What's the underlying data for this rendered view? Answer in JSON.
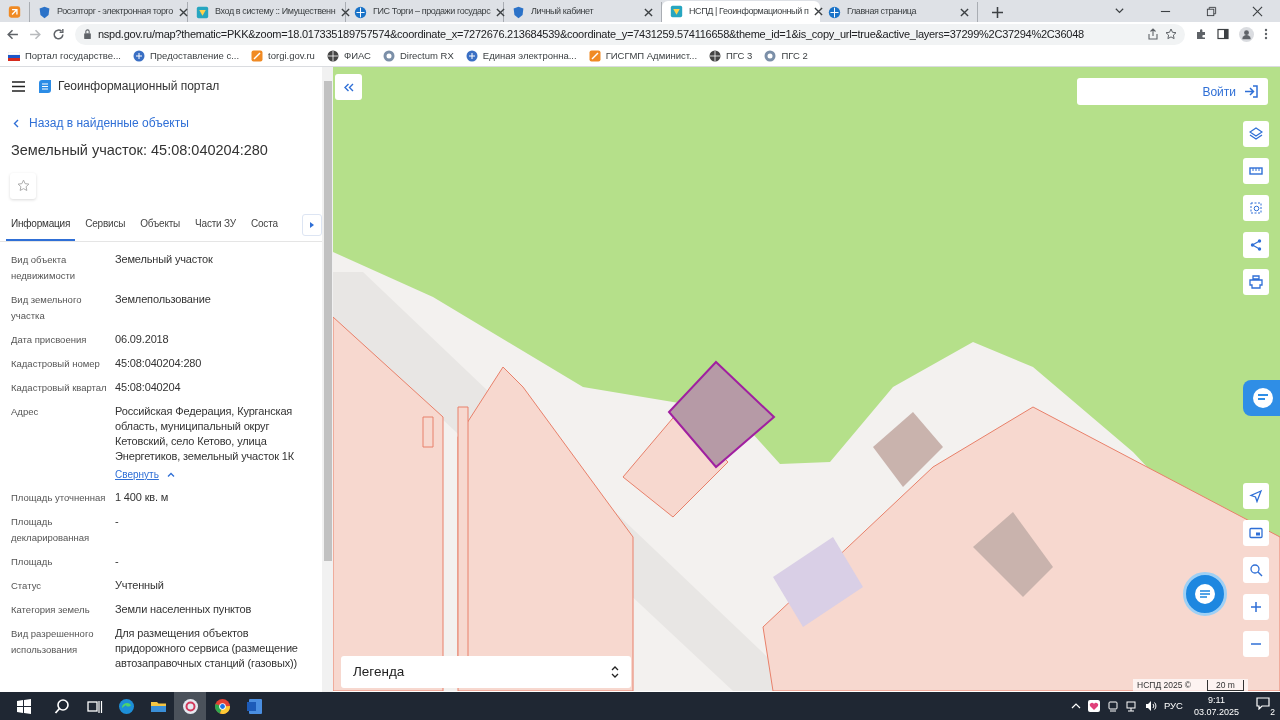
{
  "browser": {
    "tabs": [
      {
        "kind": "pinned",
        "selected": false
      },
      {
        "title": "Росэлторг - электронная торго",
        "kind": "normal",
        "selected": false
      },
      {
        "title": "Вход в систему :: Имущественн",
        "kind": "normal",
        "selected": false
      },
      {
        "title": "ГИС Торги – продажи государс",
        "kind": "normal",
        "selected": false
      },
      {
        "title": "Личный кабинет",
        "kind": "normal",
        "selected": false
      },
      {
        "title": "НСПД | Геоинформационный п",
        "kind": "normal",
        "selected": true
      },
      {
        "title": "Главная страница",
        "kind": "normal",
        "selected": false
      }
    ],
    "url": "nspd.gov.ru/map?thematic=PKK&zoom=18.017335189757574&coordinate_x=7272676.213684539&coordinate_y=7431259.574116658&theme_id=1&is_copy_url=true&active_layers=37299%2C37294%2C36048",
    "bookmarks": [
      {
        "title": "Портал государстве...",
        "kind": "flag"
      },
      {
        "title": "Предоставление с...",
        "kind": "site"
      },
      {
        "title": "torgi.gov.ru",
        "kind": "site"
      },
      {
        "title": "ФИАС",
        "kind": "site"
      },
      {
        "title": "Directum RX",
        "kind": "site"
      },
      {
        "title": "Единая электронна...",
        "kind": "site"
      },
      {
        "title": "ГИСГМП Админист...",
        "kind": "site"
      },
      {
        "title": "ПГС 3",
        "kind": "site"
      },
      {
        "title": "ПГС 2",
        "kind": "site"
      }
    ]
  },
  "app": {
    "title": "Геоинформационный портал",
    "back_link": "Назад в найденные объекты",
    "object_title": "Земельный участок: 45:08:040204:280",
    "tabs": [
      {
        "label": "Информация",
        "selected": true
      },
      {
        "label": "Сервисы",
        "selected": false
      },
      {
        "label": "Объекты",
        "selected": false
      },
      {
        "label": "Части ЗУ",
        "selected": false
      },
      {
        "label": "Соста",
        "selected": false
      }
    ],
    "fields": [
      {
        "label": "Вид объекта недвижимости",
        "value": "Земельный участок"
      },
      {
        "label": "Вид земельного участка",
        "value": "Землепользование"
      },
      {
        "label": "Дата присвоения",
        "value": "06.09.2018"
      },
      {
        "label": "Кадастровый номер",
        "value": "45:08:040204:280"
      },
      {
        "label": "Кадастровый квартал",
        "value": "45:08:040204"
      },
      {
        "label": "Адрес",
        "value": "Российская Федерация, Курганская область, муниципальный округ Кетовский, село Кетово, улица Энергетиков, земельный участок 1К",
        "collapse_link": "Свернуть"
      },
      {
        "label": "Площадь уточненная",
        "value": "1 400 кв. м"
      },
      {
        "label": "Площадь декларированная",
        "value": "-"
      },
      {
        "label": "Площадь",
        "value": "-"
      },
      {
        "label": "Статус",
        "value": "Учтенный"
      },
      {
        "label": "Категория земель",
        "value": "Земли населенных пунктов"
      },
      {
        "label": "Вид разрешенного использования",
        "value": "Для размещения объектов придорожного сервиса (размещение автозаправочных станций (газовых))"
      }
    ]
  },
  "map": {
    "login": "Войти",
    "legend": "Легенда",
    "attribution": "НСПД 2025 ©",
    "scale": "20 m"
  },
  "taskbar": {
    "language": "РУС",
    "time": "9:11",
    "date": "03.07.2025",
    "notifications": "2"
  }
}
